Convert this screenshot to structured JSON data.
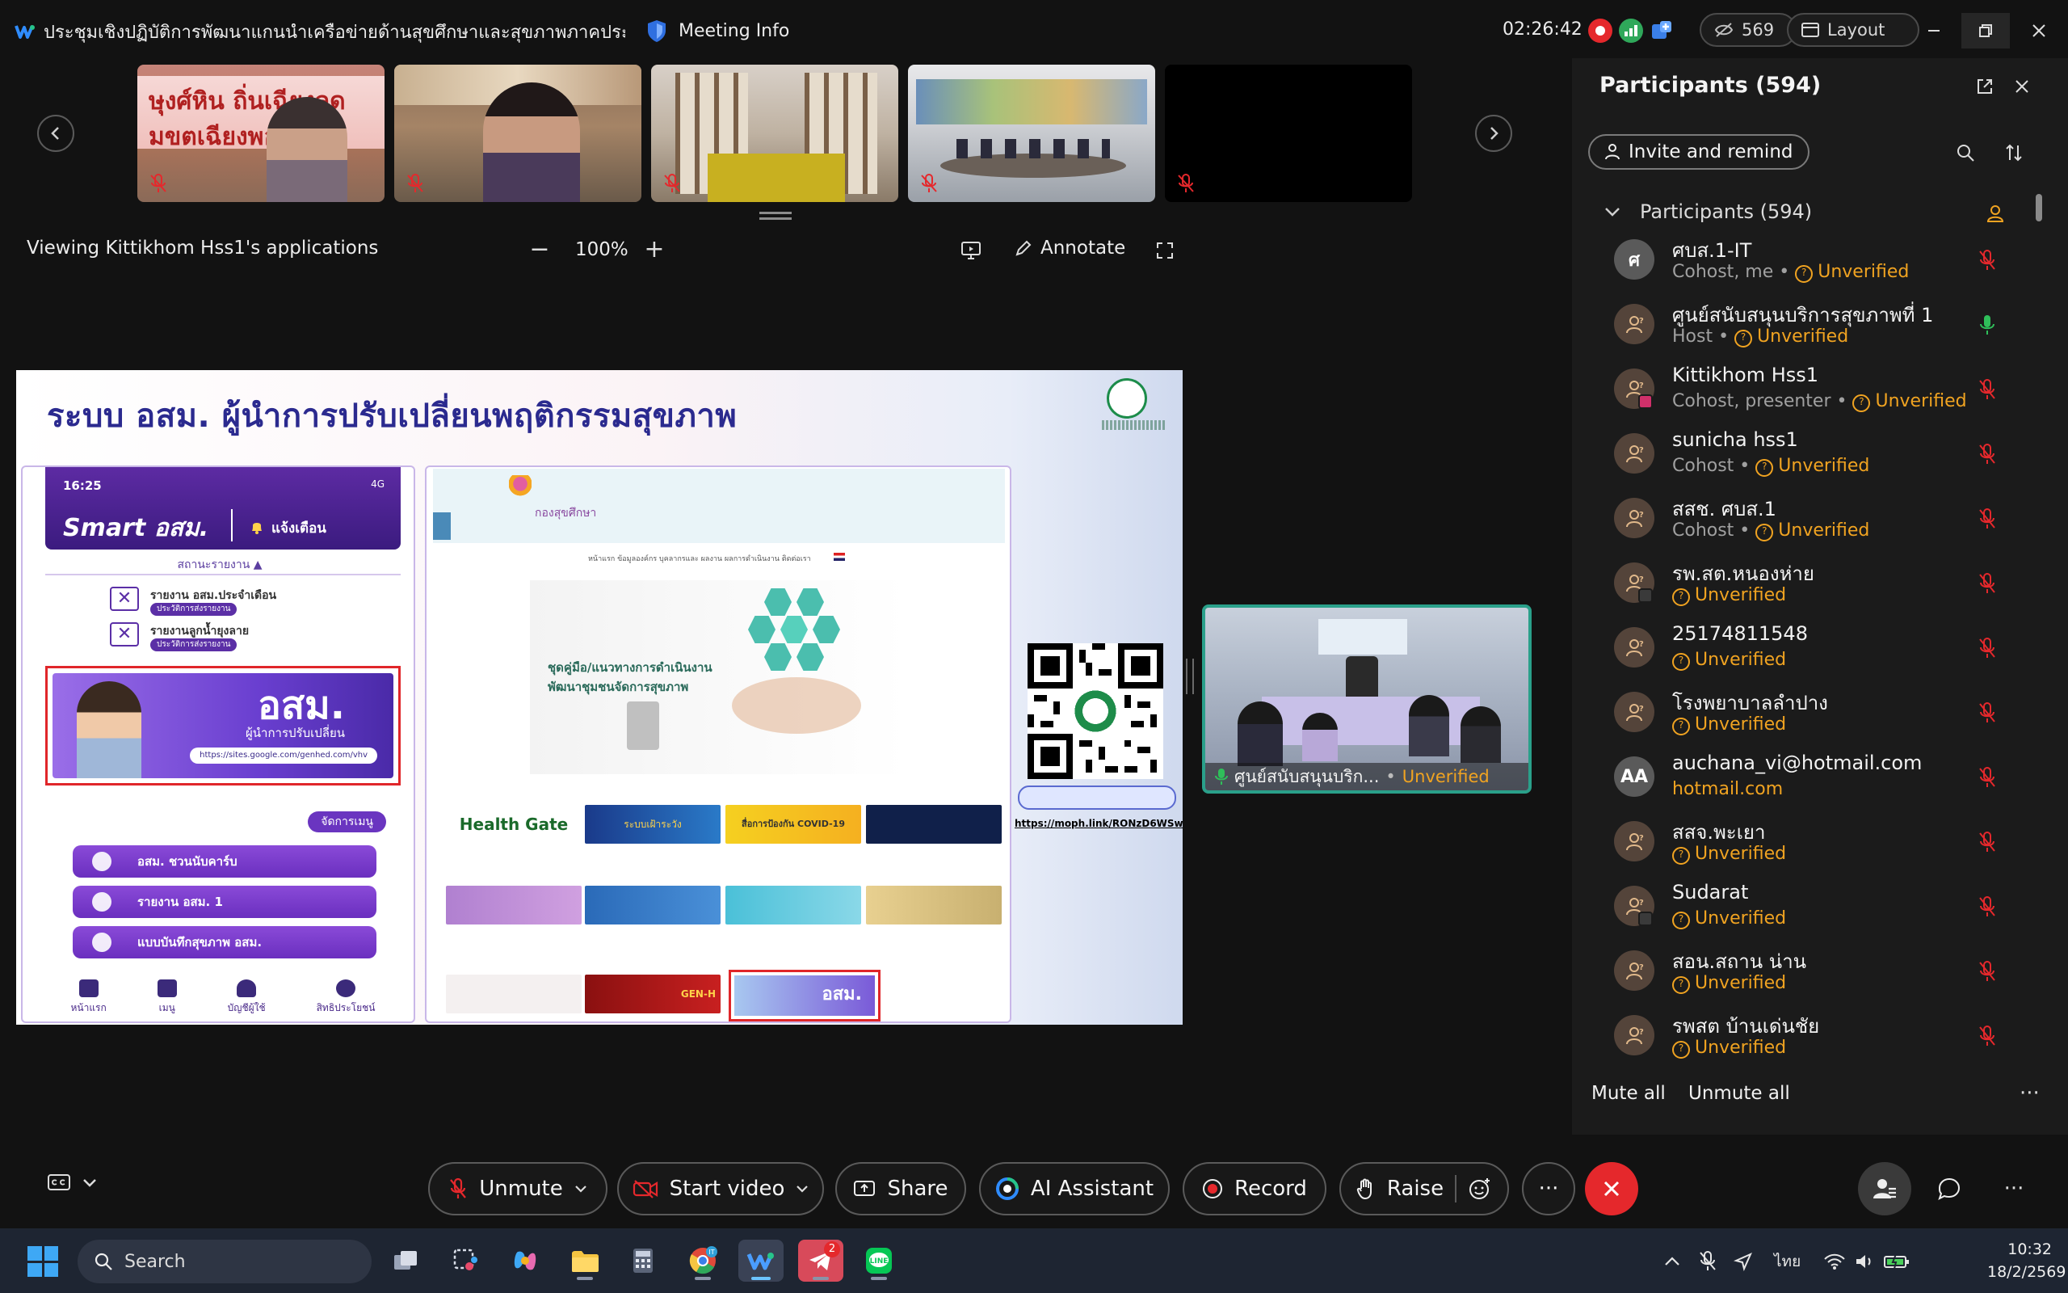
{
  "titlebar": {
    "meeting_title": "ประชุมเชิงปฏิบัติการพัฒนาแกนนำเครือข่ายด้านสุขศึกษาและสุขภาพภาคประชาชน (...",
    "meeting_info_label": "Meeting Info",
    "clock": "02:26:42",
    "attendee_count": "569",
    "layout_label": "Layout"
  },
  "toolbar": {
    "viewing_text": "Viewing Kittikhom Hss1's applications",
    "zoom_level": "100%",
    "annotate_label": "Annotate"
  },
  "slide": {
    "title": "ระบบ อสม. ผู้นำการปรับเปลี่ยนพฤติกรรมสุขภาพ",
    "phone_time": "16:25",
    "phone_status": "4G",
    "app_logo": "Smart อสม.",
    "notify_label": "แจ้งเตือน",
    "status_section": "สถานะรายงาน ▲",
    "reports": [
      {
        "label": "รายงาน อสม.ประจำเดือน",
        "sub": "ประวัติการส่งรายงาน"
      },
      {
        "label": "รายงานลูกน้ำยุงลาย",
        "sub": "ประวัติการส่งรายงาน"
      }
    ],
    "banner_big": "อสม.",
    "banner_line": "ผู้นำการปรับเปลี่ยน",
    "banner_url": "https://sites.google.com/genhed.com/vhv",
    "manage_menu": "จัดการเมนู",
    "menu_buttons": [
      "อสม. ชวนนับคาร์บ",
      "รายงาน อสม. 1",
      "แบบบันทึกสุขภาพ อสม."
    ],
    "bottom_nav": [
      "หน้าแรก",
      "เมนู",
      "บัญชีผู้ใช้",
      "สิทธิประโยชน์"
    ],
    "web_logo": "กองสุขศึกษา",
    "web_nav": "หน้าแรก   ข้อมูลองค์กร   บุคลากรและ ผลงาน   ผลการดำเนินงาน   ติดต่อเรา",
    "hero_text": [
      "ชุดคู่มือ/แนวทางการดำเนินงาน",
      "พัฒนาชุมชนจัดการสุขภาพ"
    ],
    "tiles": [
      "Health Gate",
      "ระบบเฝ้าระวัง",
      "สื่อการป้องกัน COVID-19",
      "",
      "",
      "",
      "",
      "",
      "",
      "GEN-H",
      "อสม."
    ],
    "qr_link": "https://moph.link/RONzD6WSw"
  },
  "floating_video": {
    "name": "ศูนย์สนับสนุนบริก...",
    "status": "Unverified"
  },
  "participants_panel": {
    "title": "Participants (594)",
    "invite_label": "Invite and remind",
    "section_label": "Participants (594)",
    "mute_all": "Mute all",
    "unmute_all": "Unmute all",
    "items": [
      {
        "name": "ศบส.1-IT",
        "role": "Cohost, me",
        "status": "Unverified",
        "avatar": "ศ",
        "mic": "muted"
      },
      {
        "name": "ศูนย์สนับสนุนบริการสุขภาพที่ 1",
        "role": "Host",
        "status": "Unverified",
        "avatar": "",
        "mic": "active"
      },
      {
        "name": "Kittikhom Hss1",
        "role": "Cohost, presenter",
        "status": "Unverified",
        "avatar": "",
        "mic": "muted"
      },
      {
        "name": "sunicha hss1",
        "role": "Cohost",
        "status": "Unverified",
        "avatar": "",
        "mic": "muted"
      },
      {
        "name": "สสช. ศบส.1",
        "role": "Cohost",
        "status": "Unverified",
        "avatar": "",
        "mic": "muted"
      },
      {
        "name": "รพ.สต.หนองห่าย",
        "role": "",
        "status": "Unverified",
        "avatar": "",
        "mic": "muted"
      },
      {
        "name": "25174811548",
        "role": "",
        "status": "Unverified",
        "avatar": "",
        "mic": "muted"
      },
      {
        "name": "โรงพยาบาลลำปาง",
        "role": "",
        "status": "Unverified",
        "avatar": "",
        "mic": "muted"
      },
      {
        "name": "auchana_vi@hotmail.com",
        "role": "",
        "status": "hotmail.com",
        "avatar": "AA",
        "mic": "muted"
      },
      {
        "name": "สสจ.พะเยา",
        "role": "",
        "status": "Unverified",
        "avatar": "",
        "mic": "muted"
      },
      {
        "name": "Sudarat",
        "role": "",
        "status": "Unverified",
        "avatar": "",
        "mic": "muted"
      },
      {
        "name": "สอน.สถาน น่าน",
        "role": "",
        "status": "Unverified",
        "avatar": "",
        "mic": "muted"
      },
      {
        "name": "รพสต บ้านเด่นชัย",
        "role": "",
        "status": "Unverified",
        "avatar": "",
        "mic": "muted"
      }
    ]
  },
  "controls": {
    "unmute": "Unmute",
    "start_video": "Start video",
    "share": "Share",
    "ai_assistant": "AI Assistant",
    "record": "Record",
    "raise": "Raise"
  },
  "taskbar": {
    "search_placeholder": "Search",
    "notification_badge": "2",
    "language": "ไทย",
    "time": "10:32",
    "date": "18/2/2569"
  },
  "colors": {
    "unverified": "#f0a321",
    "end_call": "#e5282c",
    "floating_border": "#2aa08a",
    "mic_muted": "#e5282c",
    "mic_active": "#2fbf5a"
  }
}
